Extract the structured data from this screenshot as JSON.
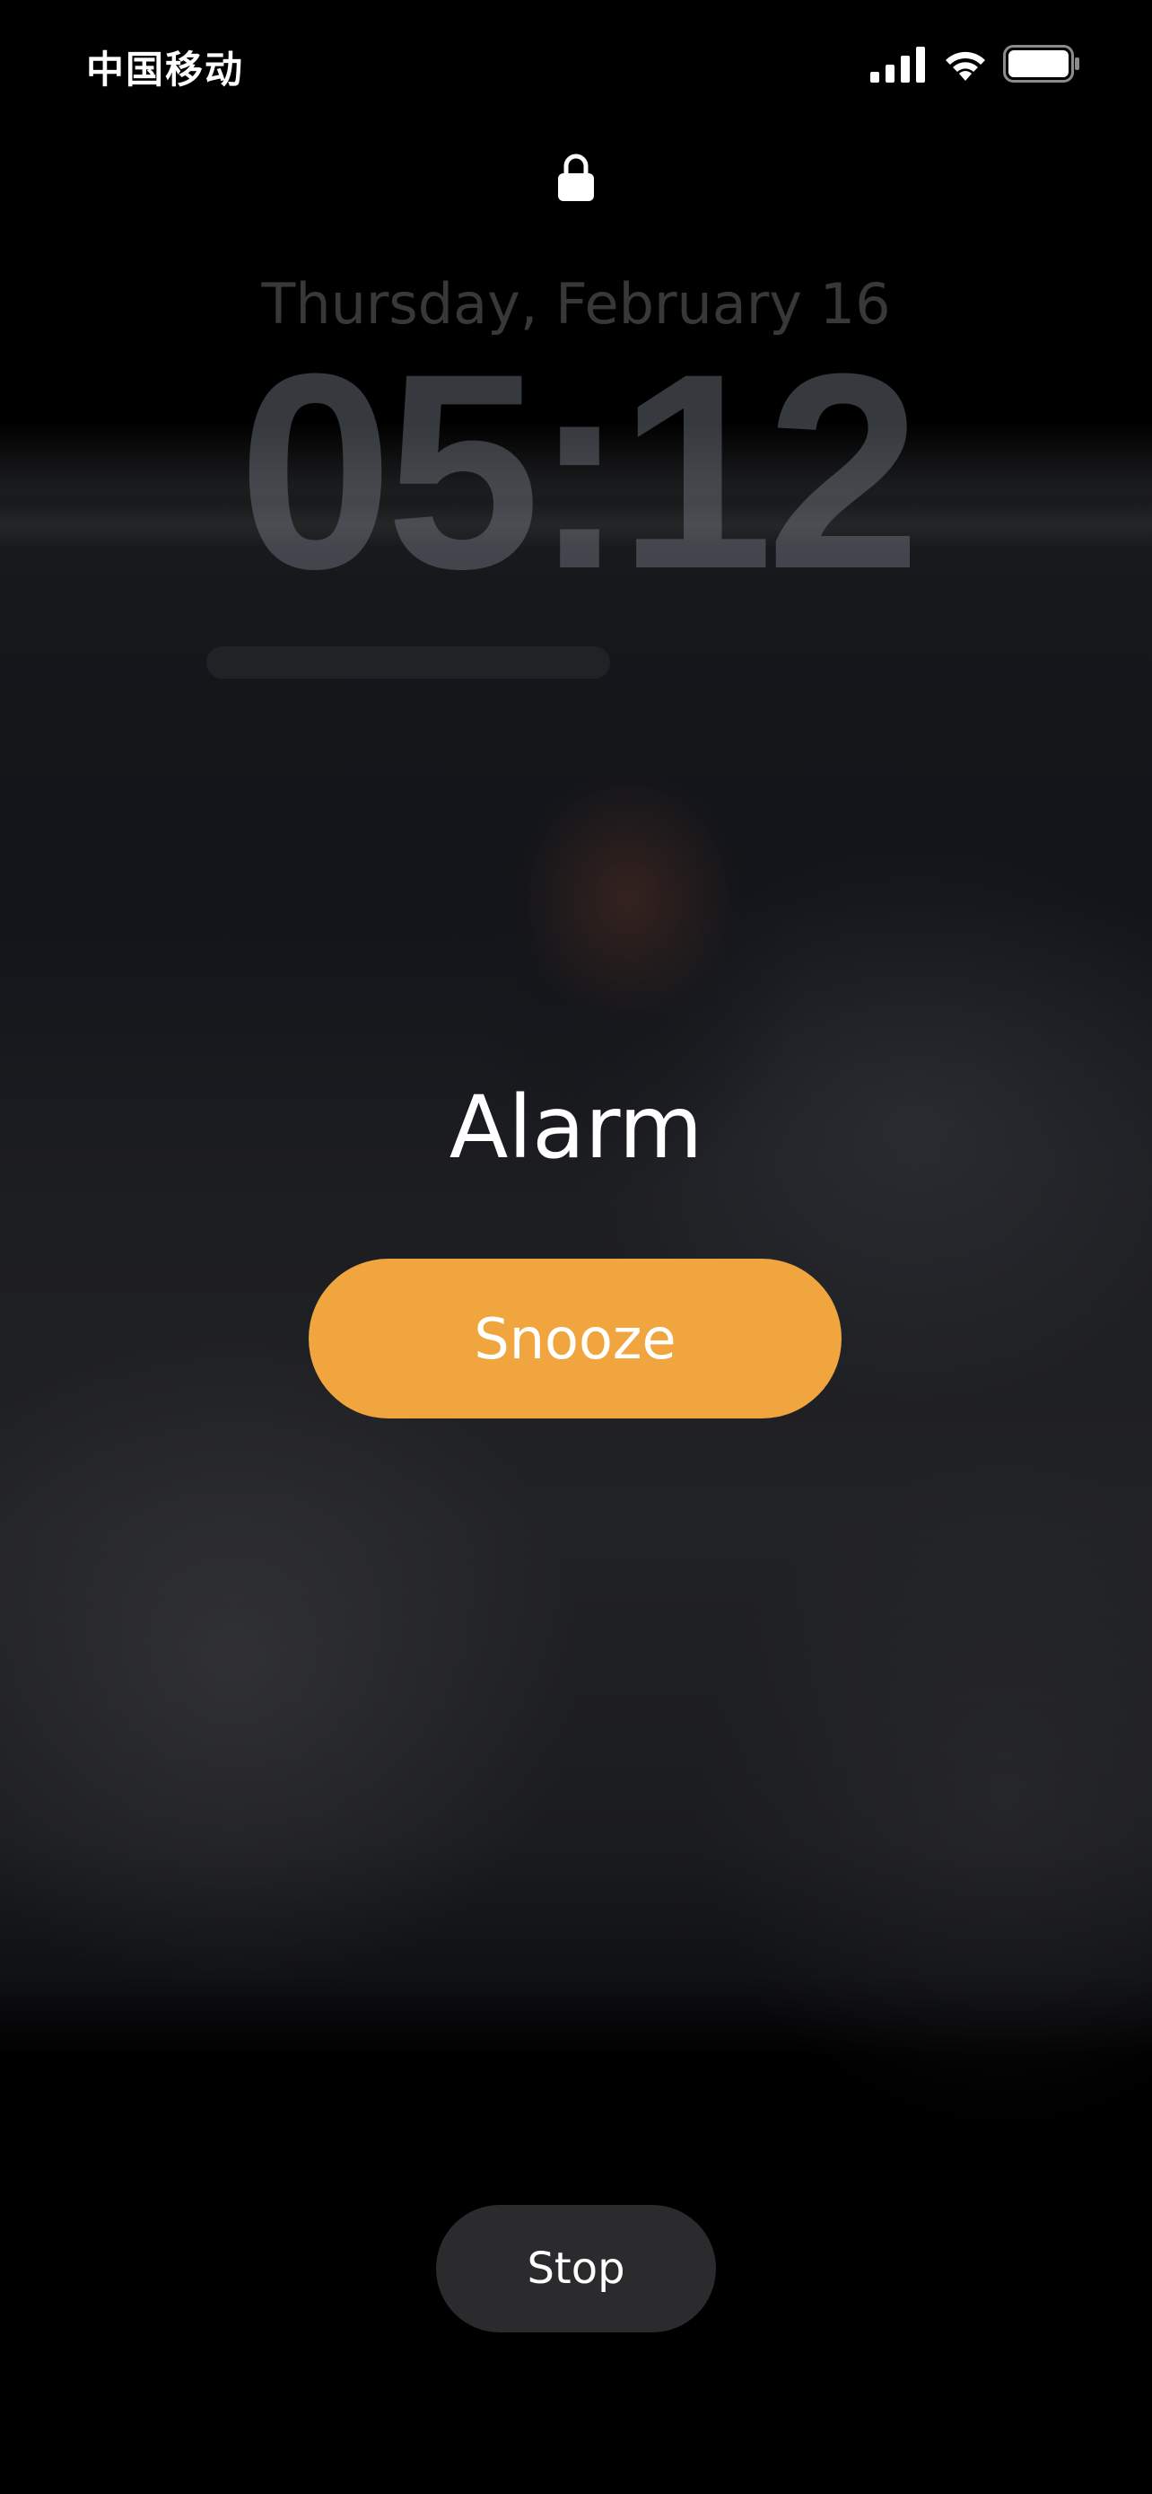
{
  "status_bar": {
    "carrier": "中国移动",
    "icons": [
      "signal-icon",
      "wifi-icon",
      "battery-icon"
    ],
    "battery_level": 1.0
  },
  "lock_screen": {
    "lock_icon": "lock-icon",
    "date": "Thursday, February 16",
    "time": "05:12"
  },
  "alarm": {
    "title": "Alarm",
    "snooze_label": "Snooze",
    "stop_label": "Stop"
  },
  "colors": {
    "snooze_button": "#f0a53e",
    "stop_button": "#2b2b2d",
    "background": "#000000"
  }
}
